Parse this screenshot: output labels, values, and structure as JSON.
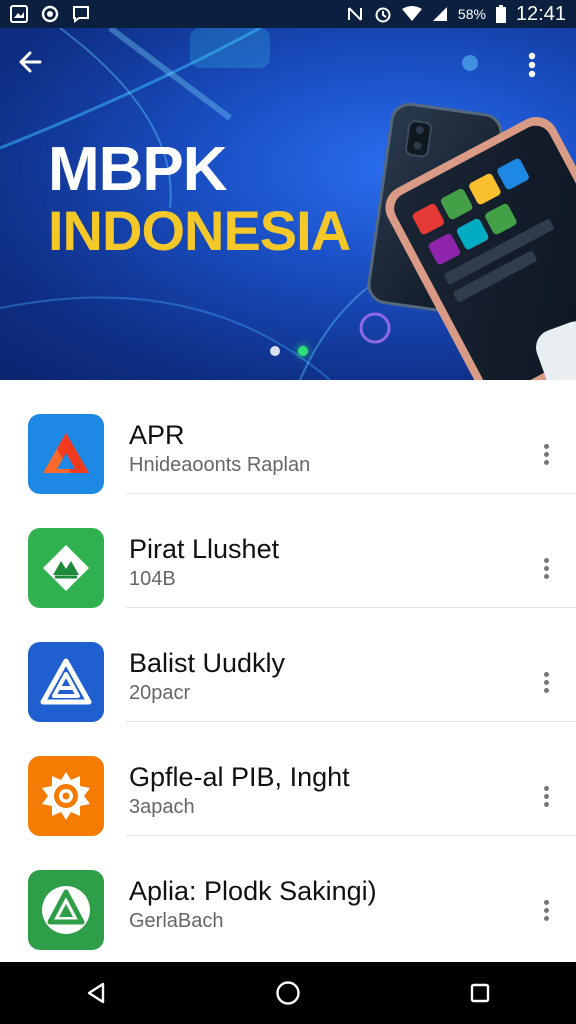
{
  "status_bar": {
    "left_icons": [
      "gallery-icon",
      "settings-circle-icon",
      "message-icon"
    ],
    "right_icons": [
      "nfc-icon",
      "alarm-icon",
      "wifi-icon",
      "signal-icon",
      "battery-icon"
    ],
    "battery_text": "58%",
    "time": "12:41"
  },
  "hero": {
    "title_line1": "MBPK",
    "title_line2": "INDONESIA",
    "slides": 2,
    "active_slide": 2,
    "colors": {
      "title_line1": "#ffffff",
      "title_line2": "#f5c82a",
      "background": "#1a4fc4"
    }
  },
  "apps": [
    {
      "name": "APR",
      "subtitle": "Hnideaoonts Raplan",
      "icon": "drive-triangle-icon",
      "color": "#1e88e5"
    },
    {
      "name": "Pirat Llushet",
      "subtitle": "104B",
      "icon": "mountain-diamond-icon",
      "color": "#2fb150"
    },
    {
      "name": "Balist Uudkly",
      "subtitle": "20pacr",
      "icon": "triangle-a-icon",
      "color": "#1f5fd0"
    },
    {
      "name": "Gpfle-al PIB, Inght",
      "subtitle": "3apach",
      "icon": "gear-target-icon",
      "color": "#f57c00"
    },
    {
      "name": "Aplia: Plodk Sakingi)",
      "subtitle": "GerlaBach",
      "icon": "circle-triangle-icon",
      "color": "#2e9e48"
    }
  ],
  "nav_bar": {
    "buttons": [
      "back-triangle-icon",
      "home-circle-icon",
      "recents-square-icon"
    ]
  }
}
